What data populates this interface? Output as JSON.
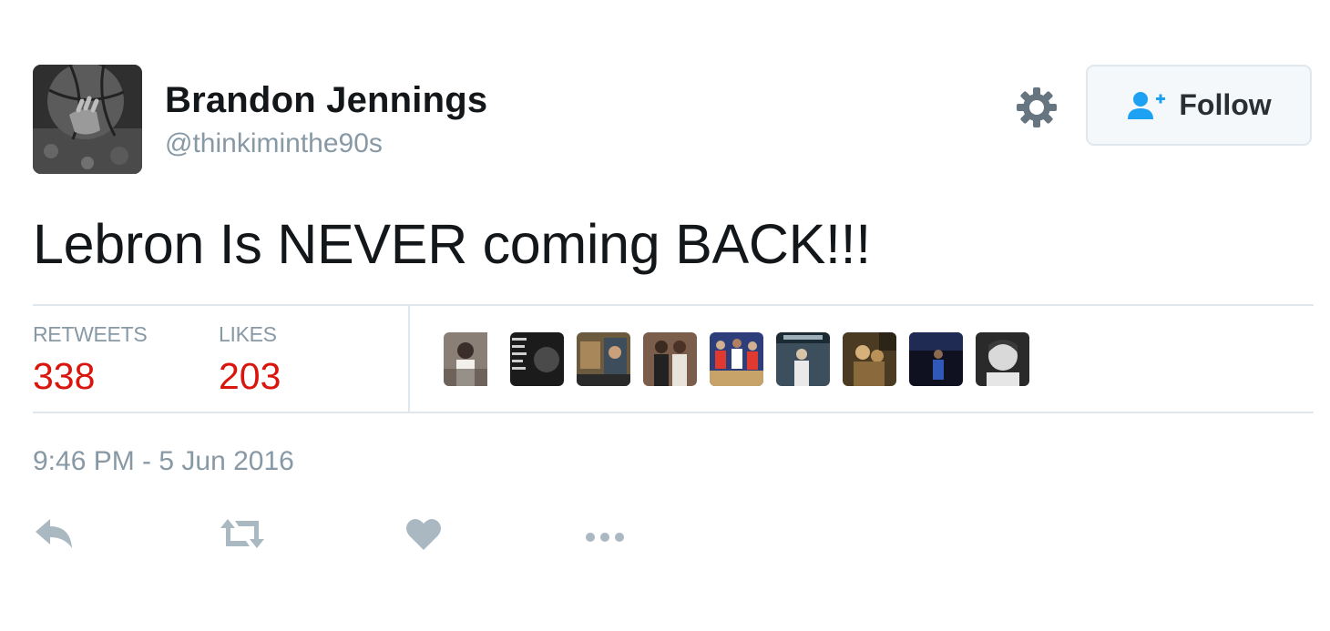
{
  "user": {
    "display_name": "Brandon Jennings",
    "handle": "@thinkiminthe90s",
    "avatar_icon": "avatar-basketball-photo"
  },
  "header": {
    "settings_icon": "gear-icon",
    "follow_label": "Follow",
    "follow_icon": "add-user-icon"
  },
  "tweet": {
    "text": "Lebron Is NEVER coming BACK!!!",
    "timestamp": "9:46 PM - 5 Jun 2016"
  },
  "stats": {
    "retweets_label": "RETWEETS",
    "retweets_count": "338",
    "likes_label": "LIKES",
    "likes_count": "203",
    "liker_avatar_count": 9
  },
  "actions": [
    {
      "name": "reply",
      "icon": "reply-icon"
    },
    {
      "name": "retweet",
      "icon": "retweet-icon"
    },
    {
      "name": "like",
      "icon": "heart-icon"
    },
    {
      "name": "more",
      "icon": "more-icon"
    }
  ],
  "colors": {
    "count_red": "#d9150d",
    "muted_gray": "#8899a6",
    "action_gray": "#aab8c2",
    "follow_blue": "#1da1f2"
  }
}
